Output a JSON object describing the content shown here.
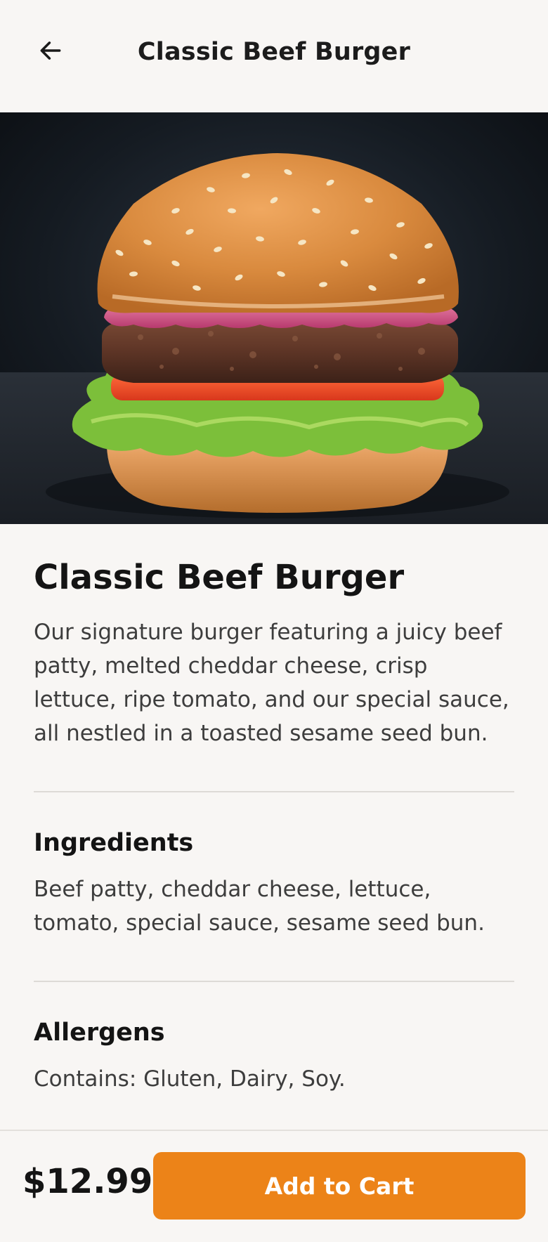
{
  "header": {
    "title": "Classic Beef Burger",
    "back_icon": "arrow-left-icon"
  },
  "hero": {
    "image_subject": "burger-photo"
  },
  "product": {
    "name": "Classic Beef Burger",
    "description": "Our signature burger featuring a juicy beef patty, melted cheddar cheese, crisp lettuce, ripe tomato, and our special sauce, all nestled in a toasted sesame seed bun."
  },
  "ingredients": {
    "title": "Ingredients",
    "text": "Beef patty, cheddar cheese, lettuce, tomato, special sauce, sesame seed bun."
  },
  "allergens": {
    "title": "Allergens",
    "text": "Contains: Gluten, Dairy, Soy."
  },
  "footer": {
    "price": "$12.99",
    "cart_label": "Add to Cart"
  },
  "colors": {
    "accent": "#ec8318",
    "background": "#f8f6f4",
    "text": "#1a1a1a"
  }
}
